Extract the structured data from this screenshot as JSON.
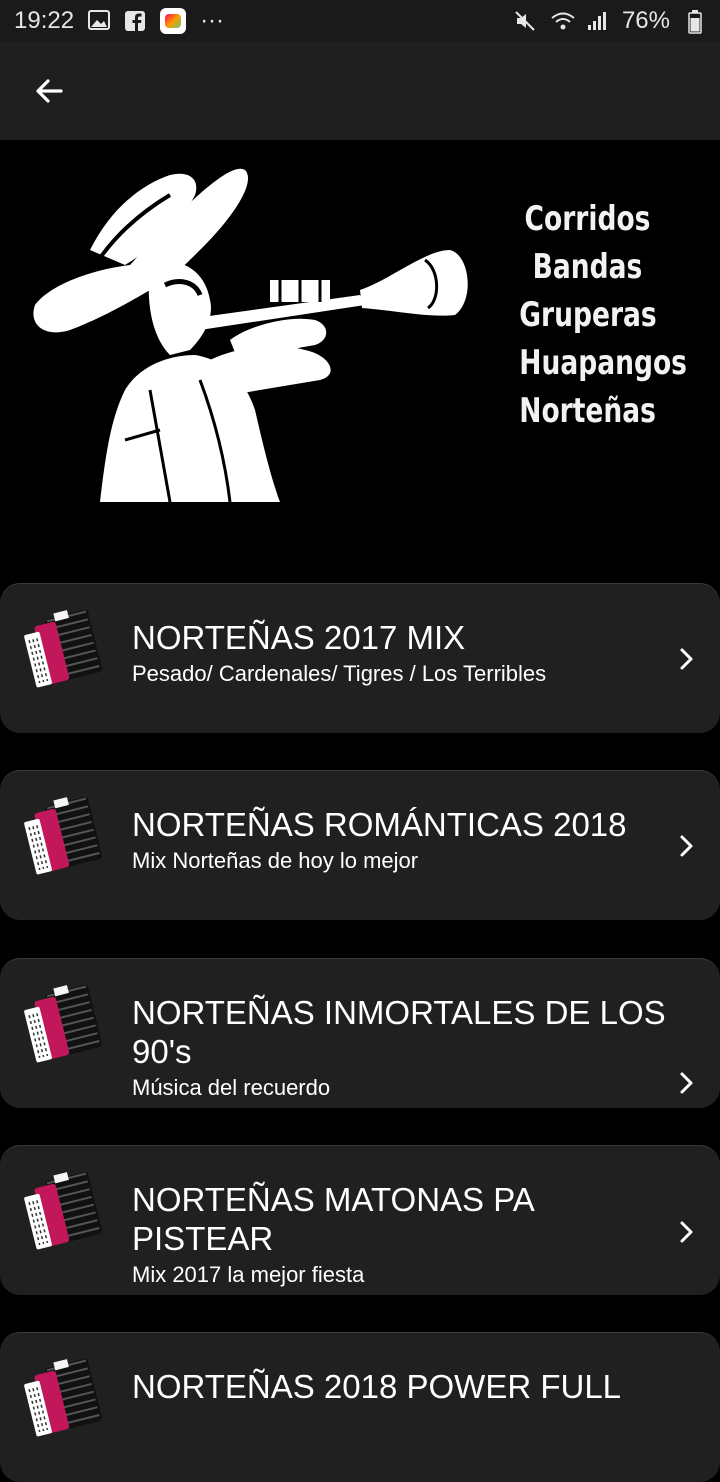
{
  "status_bar": {
    "time": "19:22",
    "more": "···",
    "battery": "76%"
  },
  "banner": {
    "genres": [
      "Corridos",
      "Bandas",
      "Gruperas",
      "Huapangos",
      "Norteñas"
    ]
  },
  "playlists": [
    {
      "title": "NORTEÑAS 2017 MIX",
      "subtitle": "Pesado/ Cardenales/ Tigres / Los Terribles"
    },
    {
      "title": "NORTEÑAS ROMÁNTICAS 2018",
      "subtitle": "Mix Norteñas de hoy lo mejor"
    },
    {
      "title": "NORTEÑAS INMORTALES DE LOS 90's",
      "subtitle": "Música del recuerdo"
    },
    {
      "title": "NORTEÑAS MATONAS PA PISTEAR",
      "subtitle": "Mix 2017 la mejor fiesta"
    },
    {
      "title": "NORTEÑAS 2018 POWER FULL",
      "subtitle": ""
    }
  ],
  "colors": {
    "background": "#000000",
    "card": "#202020",
    "toolbar": "#1f1f1f",
    "accordion_body": "#c2185b"
  },
  "icons": {
    "back": "arrow-left-icon",
    "chevron": "chevron-right-icon",
    "playlist": "accordion-icon"
  }
}
